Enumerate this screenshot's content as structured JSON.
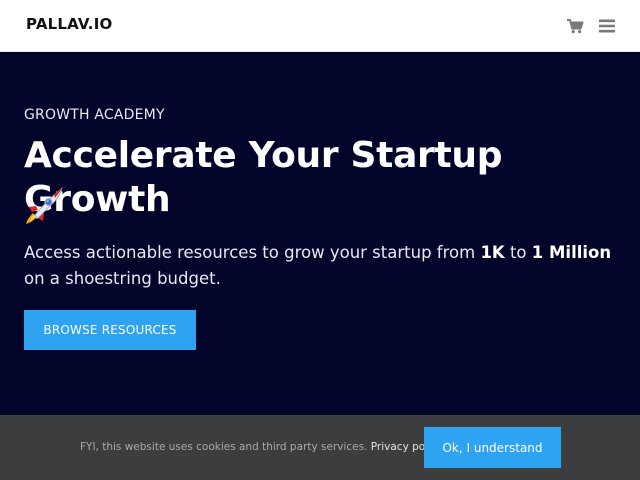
{
  "header": {
    "logo": "PALLAV.IO",
    "cart_icon": "cart-icon",
    "menu_icon": "hamburger-menu-icon"
  },
  "hero": {
    "eyebrow": "GROWTH ACADEMY",
    "headline": "Accelerate Your Startup Growth",
    "rocket_icon": "rocket-emoji-icon",
    "desc_pre": "Access actionable resources to grow your startup from ",
    "desc_bold1": "1K",
    "desc_mid": " to ",
    "desc_bold2": "1 Million",
    "desc_post": " on a shoestring budget.",
    "cta_label": "BROWSE RESOURCES"
  },
  "cookie": {
    "text": "FYI, this website uses cookies and third party services. ",
    "link": "Privacy policy",
    "text_end": ".",
    "accept_label": "Ok, I understand"
  },
  "colors": {
    "hero_bg": "#03042a",
    "accent": "#2ea3f2",
    "cookie_bg": "#3c3d3f"
  }
}
